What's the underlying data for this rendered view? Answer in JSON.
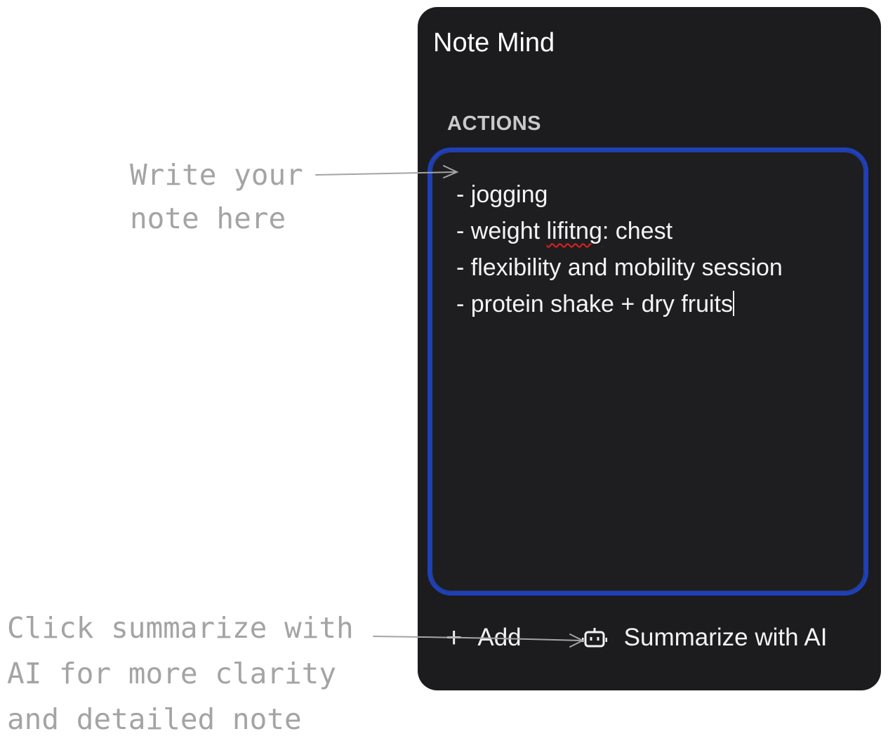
{
  "app": {
    "title": "Note Mind"
  },
  "section": {
    "label": "ACTIONS"
  },
  "note": {
    "lines": [
      "- jogging",
      "- weight lifitng: chest",
      "- flexibility and mobility session",
      "- protein shake + dry fruits"
    ],
    "misspelled_word": "lifitng"
  },
  "footer": {
    "add_label": "Add",
    "add_icon": "plus-icon",
    "summarize_label": "Summarize with AI",
    "summarize_icon": "robot-icon"
  },
  "annotations": {
    "write": "Write your\nnote here",
    "summarize": "Click summarize with\nAI for more clarity\nand detailed note"
  },
  "colors": {
    "panel_bg": "#1c1c1e",
    "note_border": "#1e40b8",
    "annotation_text": "#a4a4a4",
    "spellcheck": "#e02020"
  }
}
